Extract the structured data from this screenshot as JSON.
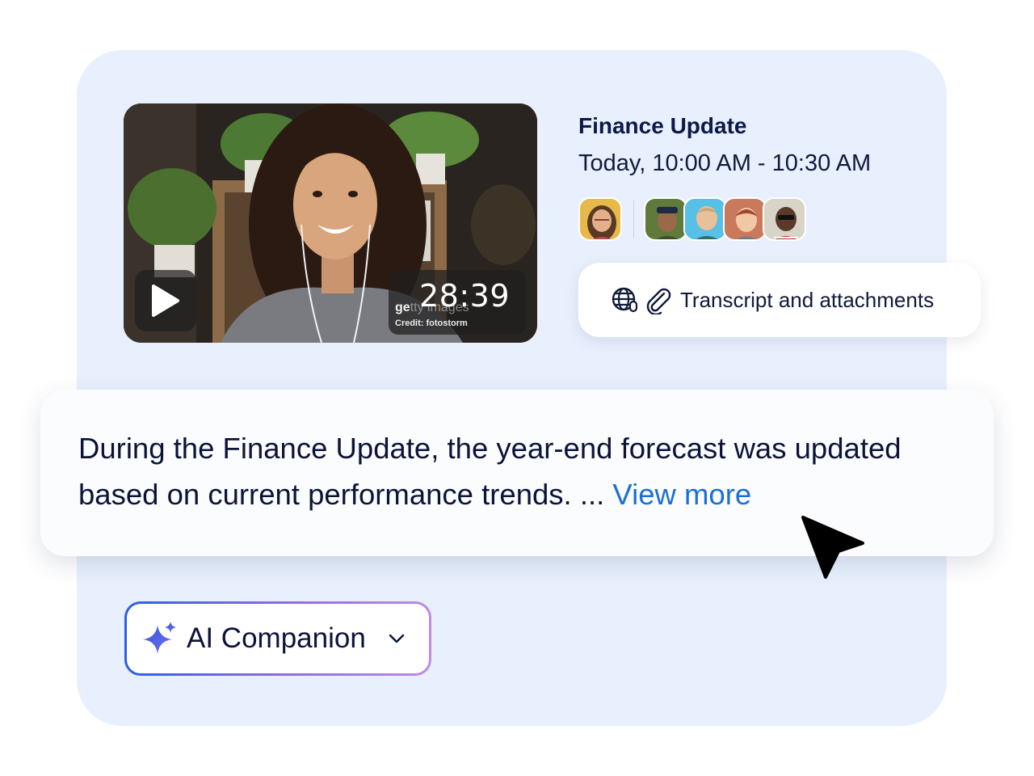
{
  "meeting": {
    "title": "Finance Update",
    "time": "Today, 10:00 AM - 10:30 AM",
    "participants": [
      {
        "name": "host-avatar",
        "bg": "#e9b84a"
      },
      {
        "name": "participant-avatar-1",
        "bg": "#5f7a3a"
      },
      {
        "name": "participant-avatar-2",
        "bg": "#57c0e6"
      },
      {
        "name": "participant-avatar-3",
        "bg": "#c97a5c"
      },
      {
        "name": "participant-avatar-4",
        "bg": "#d9d4c8"
      }
    ]
  },
  "video": {
    "duration": "28:39",
    "watermark_bold": "ge",
    "watermark_dim": "tty images",
    "credit": "Credit: fotostorm"
  },
  "transcript": {
    "label": "Transcript and attachments"
  },
  "summary": {
    "text": "During the Finance Update, the year-end forecast was updated based on current performance trends. ...",
    "view_more": "View more"
  },
  "ai_companion": {
    "label": "AI Companion"
  },
  "colors": {
    "panel_bg": "#e8f0fd",
    "accent_link": "#1a6fd6",
    "title_navy": "#0b1a4a"
  }
}
